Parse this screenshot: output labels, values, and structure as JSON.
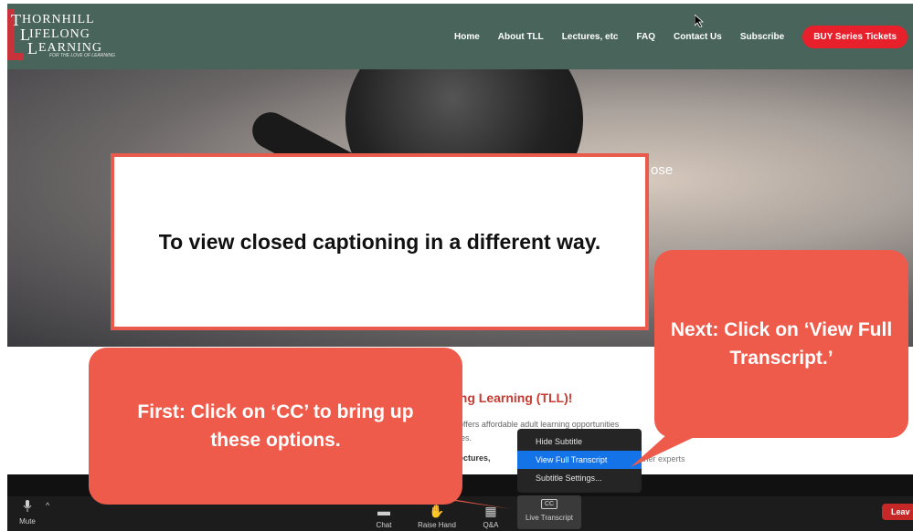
{
  "header": {
    "logo_line1": "HORNHILL",
    "logo_line2": "IFELONG",
    "logo_line3": "EARNING",
    "logo_tagline": "FOR THE LOVE OF LEARNING",
    "nav": [
      "Home",
      "About TLL",
      "Lectures, etc",
      "FAQ",
      "Contact Us",
      "Subscribe"
    ],
    "buy_button": "BUY Series Tickets",
    "colors": {
      "header_bg": "#49645a",
      "buy_bg": "#e8202c",
      "logo_red": "#c8333b"
    }
  },
  "hero": {
    "partial_text": "ose"
  },
  "content": {
    "heading_partial": "ifelong Learning (TLL)!",
    "para1_partial": "hat offers affordable adult learning opportunities",
    "para2_partial": "munities.",
    "para3_partial": "ine lectures,",
    "para4_partial": "ther experts"
  },
  "callouts": {
    "main": "To view closed captioning in a different way.",
    "first": "First: Click on ‘CC’  to bring up these options.",
    "next": "Next: Click on ‘View Full Transcript.’",
    "color": "#ef5b4b"
  },
  "cc_menu": {
    "items": [
      "Hide Subtitle",
      "View Full Transcript",
      "Subtitle Settings..."
    ],
    "selected": "View Full Transcript",
    "highlight_color": "#1473e6"
  },
  "toolbar": {
    "mute": "Mute",
    "chat": "Chat",
    "raise_hand": "Raise Hand",
    "qa": "Q&A",
    "cc_icon_text": "CC",
    "live_transcript": "Live Transcript",
    "leave": "Leav"
  }
}
